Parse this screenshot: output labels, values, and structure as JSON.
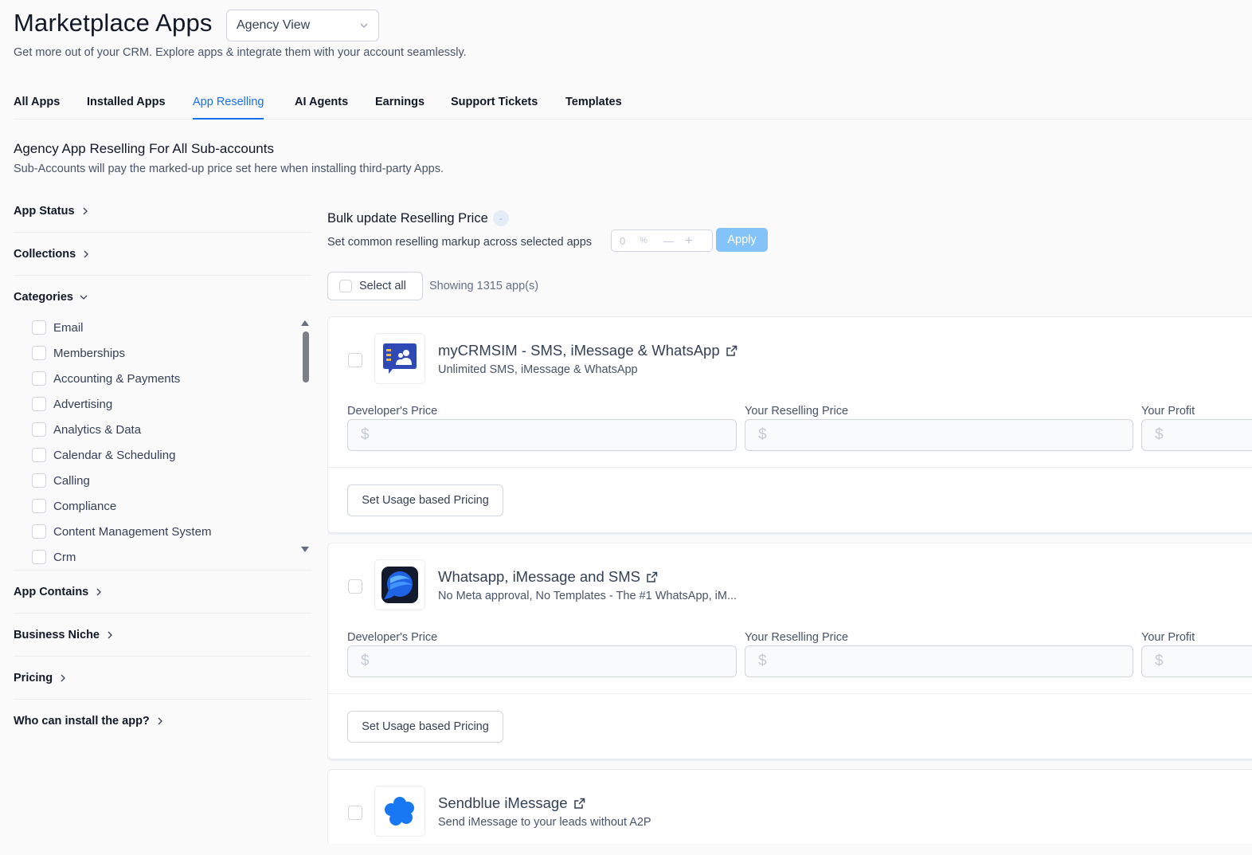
{
  "header": {
    "title": "Marketplace Apps",
    "view_select": "Agency View",
    "subtitle": "Get more out of your CRM. Explore apps & integrate them with your account seamlessly."
  },
  "tabs": [
    {
      "label": "All Apps",
      "active": false
    },
    {
      "label": "Installed Apps",
      "active": false
    },
    {
      "label": "App Reselling",
      "active": true
    },
    {
      "label": "AI Agents",
      "active": false
    },
    {
      "label": "Earnings",
      "active": false
    },
    {
      "label": "Support Tickets",
      "active": false
    },
    {
      "label": "Templates",
      "active": false
    }
  ],
  "section": {
    "title": "Agency App Reselling For All Sub-accounts",
    "subtitle": "Sub-Accounts will pay the marked-up price set here when installing third-party Apps."
  },
  "filters": {
    "app_status": "App Status",
    "collections": "Collections",
    "categories": "Categories",
    "category_items": [
      "Email",
      "Memberships",
      "Accounting & Payments",
      "Advertising",
      "Analytics & Data",
      "Calendar & Scheduling",
      "Calling",
      "Compliance",
      "Content Management System",
      "Crm"
    ],
    "app_contains": "App Contains",
    "business_niche": "Business Niche",
    "pricing": "Pricing",
    "who_can_install": "Who can install the app?"
  },
  "bulk": {
    "title": "Bulk update Reselling Price",
    "badge": "-",
    "subtitle": "Set common reselling markup across selected apps",
    "markup_value": "0",
    "markup_unit": "%",
    "minus": "—",
    "plus": "+",
    "apply_label": "Apply"
  },
  "list": {
    "select_all": "Select all",
    "showing": "Showing 1315 app(s)"
  },
  "labels": {
    "developer_price": "Developer's Price",
    "reselling_price": "Your Reselling Price",
    "profit": "Your Profit",
    "currency": "$",
    "usage_button": "Set Usage based Pricing"
  },
  "apps": [
    {
      "name": "myCRMSIM - SMS, iMessage & WhatsApp",
      "description": "Unlimited SMS, iMessage & WhatsApp"
    },
    {
      "name": "Whatsapp, iMessage and SMS",
      "description": "No Meta approval, No Templates - The #1 WhatsApp, iM..."
    },
    {
      "name": "Sendblue iMessage",
      "description": "Send iMessage to your leads without A2P"
    }
  ],
  "colors": {
    "accent": "#1570ef",
    "apply_button": "#84c3f8",
    "text_primary": "#101828",
    "text_secondary": "#475467"
  }
}
